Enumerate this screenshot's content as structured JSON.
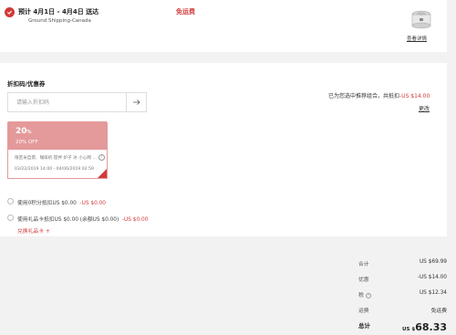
{
  "shipping": {
    "delivery_estimate": "预计 4月1日 - 4月4日 送达",
    "method": "Ground Shipping-Canada",
    "fee_label": "免运费",
    "view_details": "查看详情"
  },
  "coupons": {
    "section_title": "折扣码/优惠券",
    "input_placeholder": "请输入折扣码",
    "recommendation_prefix": "已为您选中推荐组合，共抵扣",
    "recommendation_amount": "-US $14.00",
    "change_label": "更改",
    "voucher": {
      "percent": "20",
      "percent_sign": "%",
      "off_label": "20% OFF",
      "description": "限定米自煲、咖啡机 搅拌 炉子 冰 小心网 ...",
      "info_icon": "?",
      "dates": "03/22/2019 14:00 - 04/06/2019 02:59"
    },
    "points_option": "使用0积分抵扣US $0.00",
    "points_amount": "-US $0.00",
    "giftcard_option": "使用礼品卡抵扣US $0.00 (余额US $0.00)",
    "giftcard_amount": "-US $0.00",
    "redeem_label": "兑换礼品卡 +"
  },
  "summary": {
    "subtotal_label": "合计",
    "subtotal_value": "US $69.99",
    "discount_label": "优惠",
    "discount_value": "-US $14.00",
    "tax_label": "税",
    "tax_value": "US $12.34",
    "shipping_label": "运费",
    "shipping_value": "免运费",
    "total_label": "总计",
    "total_currency": "US $",
    "total_value": "68.33"
  },
  "colors": {
    "accent": "#d13a3a",
    "voucher": "#e4999a"
  }
}
